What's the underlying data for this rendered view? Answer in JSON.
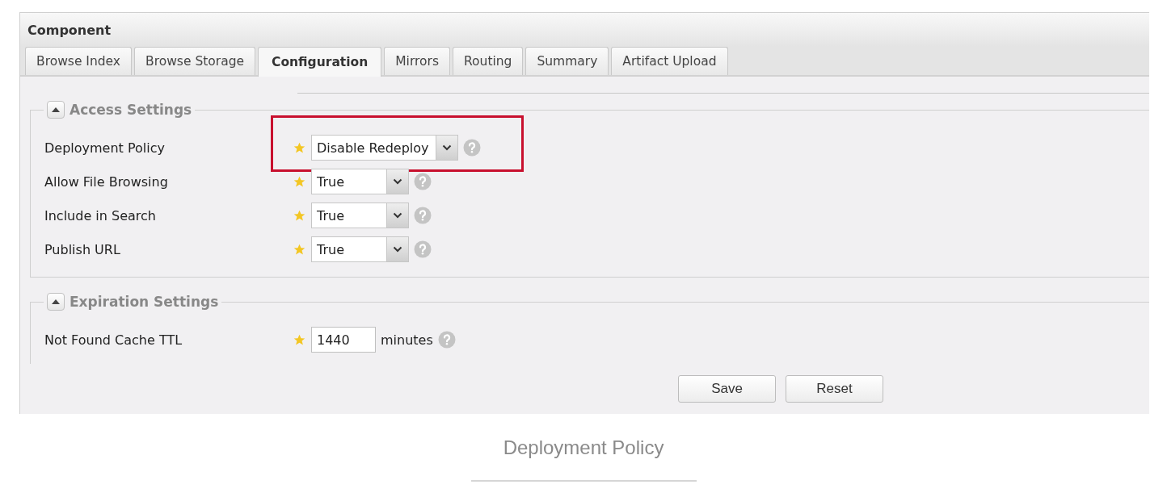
{
  "panel": {
    "title": "Component"
  },
  "tabs": [
    {
      "label": "Browse Index",
      "selected": false
    },
    {
      "label": "Browse Storage",
      "selected": false
    },
    {
      "label": "Configuration",
      "selected": true
    },
    {
      "label": "Mirrors",
      "selected": false
    },
    {
      "label": "Routing",
      "selected": false
    },
    {
      "label": "Summary",
      "selected": false
    },
    {
      "label": "Artifact Upload",
      "selected": false
    }
  ],
  "sections": [
    {
      "title": "Access Settings",
      "expanded": true,
      "fields": [
        {
          "label": "Deployment Policy",
          "kind": "select",
          "value": "Disable Redeploy",
          "required": true,
          "highlighted": true
        },
        {
          "label": "Allow File Browsing",
          "kind": "select",
          "value": "True",
          "required": true,
          "highlighted": false
        },
        {
          "label": "Include in Search",
          "kind": "select",
          "value": "True",
          "required": true,
          "highlighted": false
        },
        {
          "label": "Publish URL",
          "kind": "select",
          "value": "True",
          "required": true,
          "highlighted": false
        }
      ]
    },
    {
      "title": "Expiration Settings",
      "expanded": true,
      "fields": [
        {
          "label": "Not Found Cache TTL",
          "kind": "number",
          "value": "1440",
          "unit": "minutes",
          "required": true,
          "highlighted": false
        }
      ]
    }
  ],
  "buttons": [
    "Save",
    "Reset"
  ],
  "caption": "Deployment Policy"
}
